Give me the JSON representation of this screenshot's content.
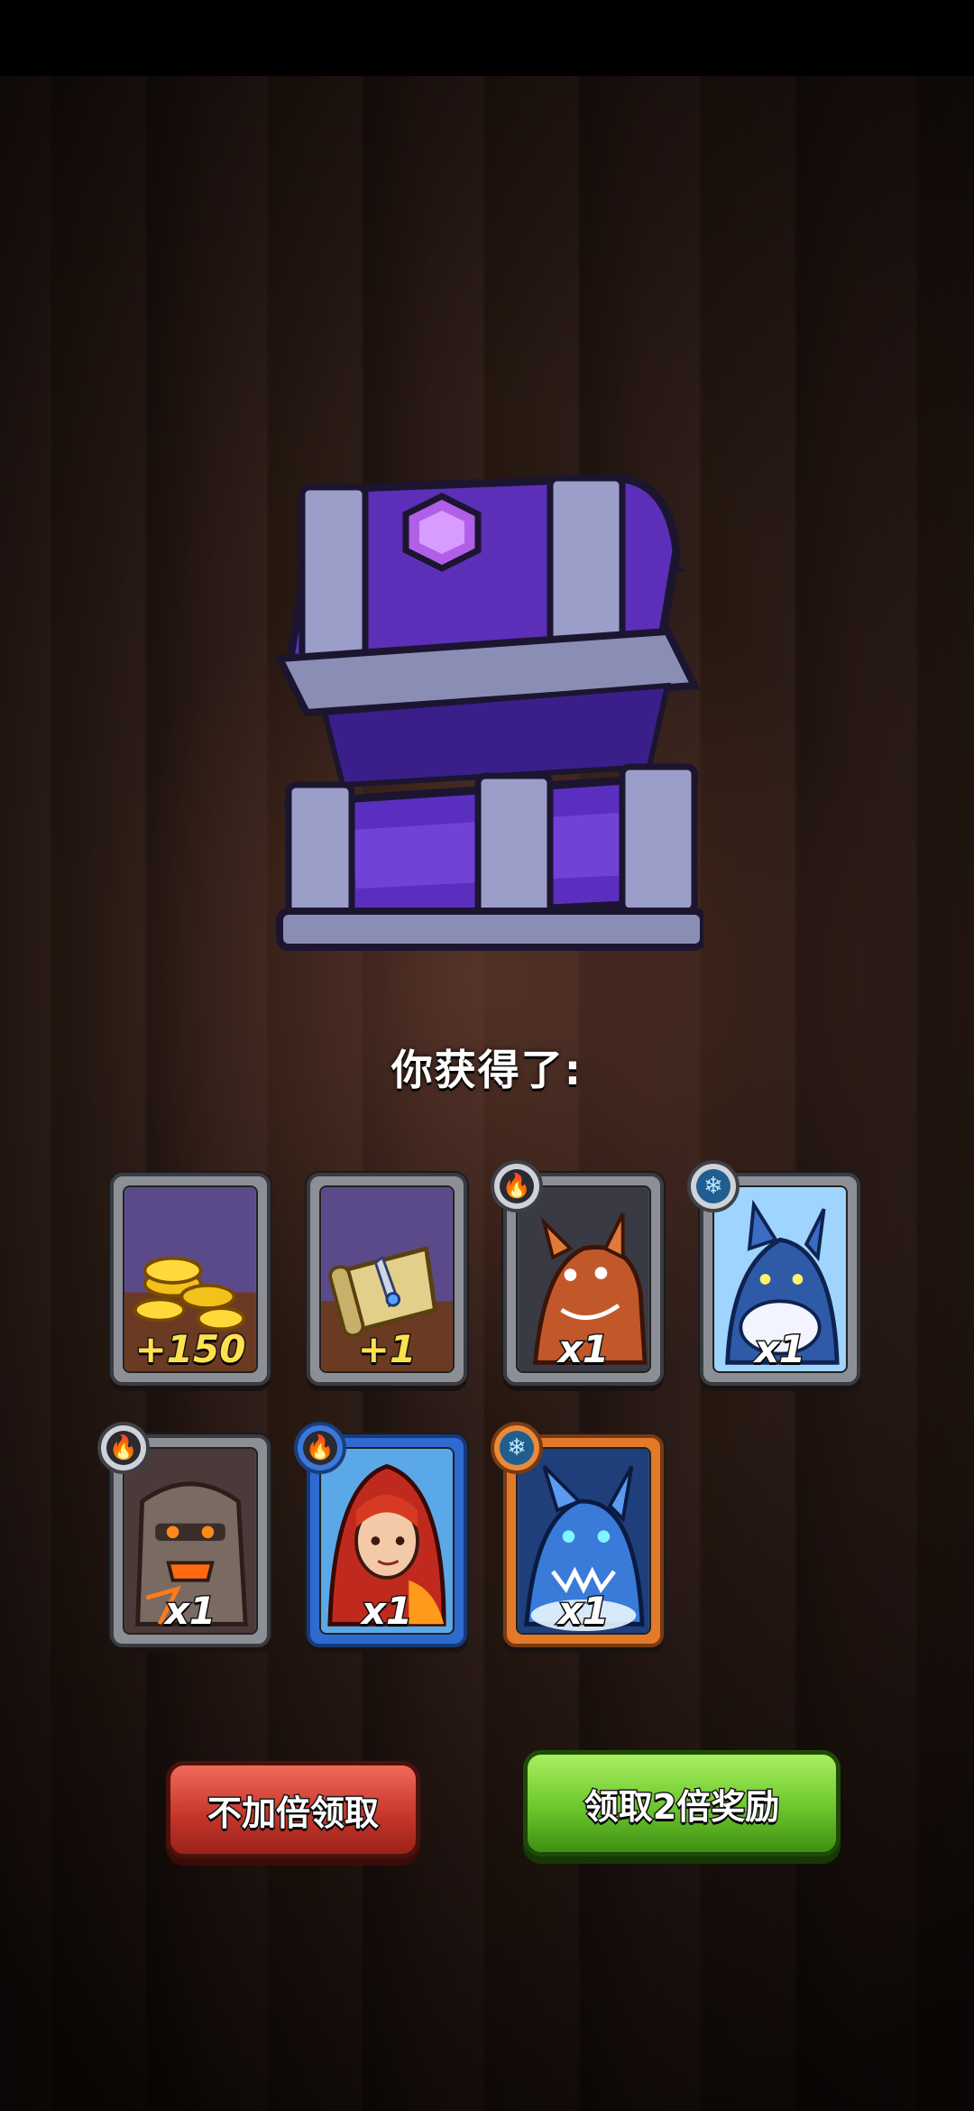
{
  "header": {
    "title": "你获得了:"
  },
  "rewards": [
    {
      "kind": "gold-coins",
      "qty": "+150",
      "element": "",
      "rarity": "common",
      "icon": "gold-coins-icon"
    },
    {
      "kind": "scroll",
      "qty": "+1",
      "element": "",
      "rarity": "common",
      "icon": "scroll-icon"
    },
    {
      "kind": "fire-dragon",
      "qty": "x1",
      "element": "fire",
      "rarity": "common",
      "icon": "dragon-hero-icon"
    },
    {
      "kind": "ice-wolf",
      "qty": "x1",
      "element": "ice",
      "rarity": "common",
      "icon": "wolf-hero-icon"
    },
    {
      "kind": "lava-golem",
      "qty": "x1",
      "element": "fire",
      "rarity": "common",
      "icon": "golem-hero-icon"
    },
    {
      "kind": "fire-mage",
      "qty": "x1",
      "element": "fire",
      "rarity": "rare",
      "icon": "mage-hero-icon"
    },
    {
      "kind": "ice-dragon",
      "qty": "x1",
      "element": "ice",
      "rarity": "epic",
      "icon": "ice-dragon-hero-icon"
    }
  ],
  "buttons": {
    "claim_label": "不加倍领取",
    "double_label": "领取2倍奖励"
  },
  "colors": {
    "chest": "#6a3fd0",
    "red_button": "#c8372c",
    "green_button": "#6cc62c"
  }
}
